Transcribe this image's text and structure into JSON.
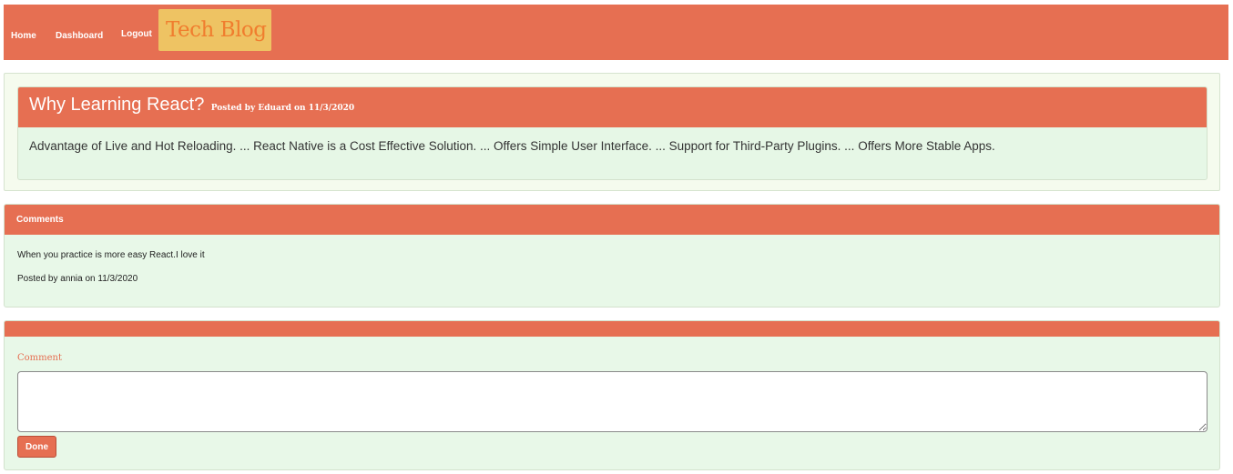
{
  "nav": {
    "home": "Home",
    "dashboard": "Dashboard",
    "logout": "Logout",
    "brand": "Tech Blog"
  },
  "post": {
    "title": "Why Learning React?",
    "meta": "Posted by Eduard on 11/3/2020",
    "body": "Advantage of Live and Hot Reloading. ... React Native is a Cost Effective Solution. ... Offers Simple User Interface. ... Support for Third-Party Plugins. ... Offers More Stable Apps."
  },
  "comments": {
    "heading": "Comments",
    "items": [
      {
        "text": "When you practice is more easy React.I love it",
        "meta": "Posted by annia on 11/3/2020"
      }
    ]
  },
  "form": {
    "label": "Comment",
    "value": "",
    "submit_label": "Done"
  },
  "colors": {
    "accent": "#e66f52",
    "brand_bg": "#eec363",
    "brand_text": "#f07d2e",
    "panel_bg": "#e8f8e8"
  }
}
